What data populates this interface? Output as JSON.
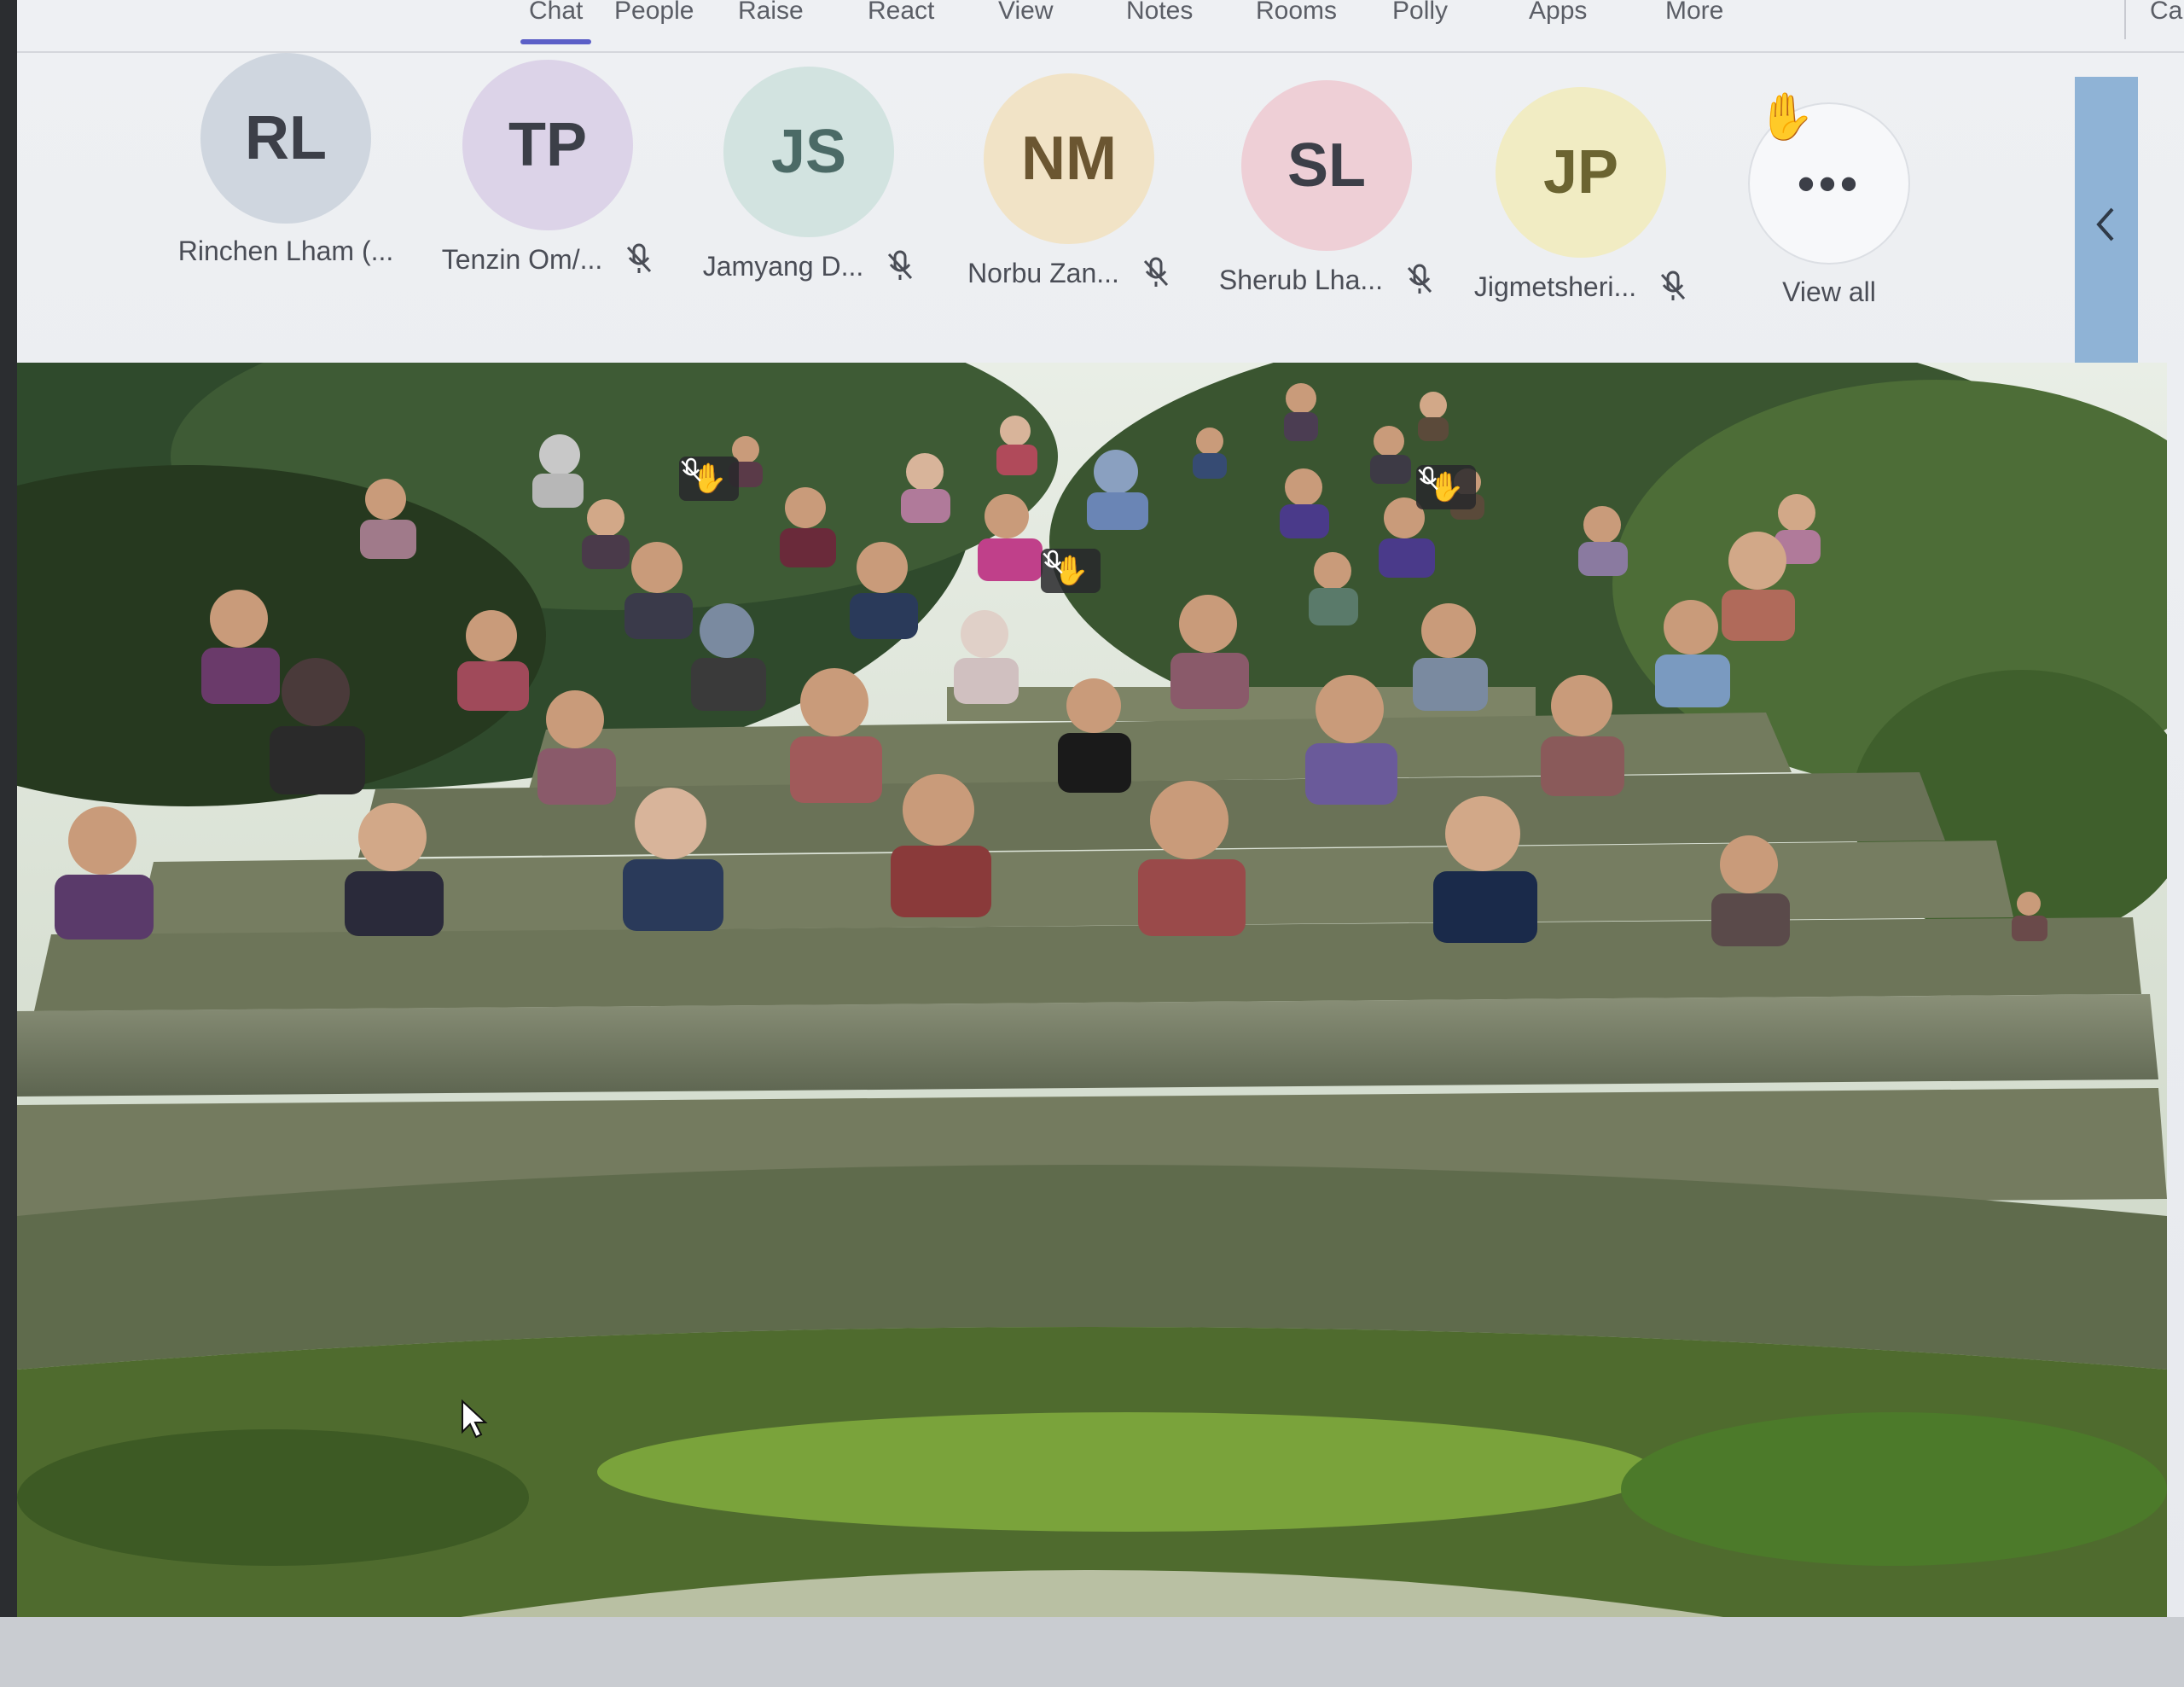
{
  "toolbar": {
    "items": [
      "Chat",
      "People",
      "Raise",
      "React",
      "View",
      "Notes",
      "Rooms",
      "Polly",
      "Apps",
      "More",
      "Ca"
    ]
  },
  "participants": [
    {
      "initials": "RL",
      "name": "Rinchen Lham (...",
      "color": "#cfd6df",
      "muted": false
    },
    {
      "initials": "TP",
      "name": "Tenzin Om/...",
      "color": "#dcd3e8",
      "muted": true
    },
    {
      "initials": "JS",
      "name": "Jamyang D...",
      "color": "#d2e3e0",
      "muted": true
    },
    {
      "initials": "NM",
      "name": "Norbu Zan...",
      "color": "#f1e3c6",
      "muted": true
    },
    {
      "initials": "SL",
      "name": "Sherub Lha...",
      "color": "#eecfd6",
      "muted": true
    },
    {
      "initials": "JP",
      "name": "Jigmetsheri...",
      "color": "#f1ecc3",
      "muted": true
    }
  ],
  "view_all": {
    "label": "View all",
    "icon": "more-dots-icon"
  },
  "raised_hand_icon": "raised-hand-icon",
  "collapse_icon": "chevron-left-icon",
  "stage": {
    "scene": "together-mode-amphitheater",
    "accent_hand": "#f2c94c"
  }
}
